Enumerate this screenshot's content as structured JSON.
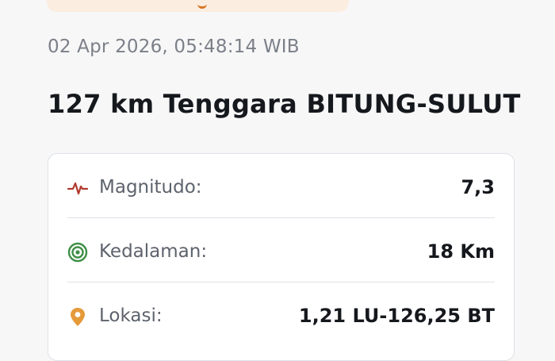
{
  "event": {
    "timestamp": "02 Apr 2026, 05:48:14 WIB",
    "title": "127 km Tenggara BITUNG-SULUT"
  },
  "details": [
    {
      "icon": "seismograph-icon",
      "label": "Magnitudo:",
      "value": "7,3",
      "color": "#b23a2e"
    },
    {
      "icon": "depth-target-icon",
      "label": "Kedalaman:",
      "value": "18 Km",
      "color": "#3e8e45"
    },
    {
      "icon": "location-pin-icon",
      "label": "Lokasi:",
      "value": "1,21 LU-126,25 BT",
      "color": "#e59a3a"
    }
  ]
}
